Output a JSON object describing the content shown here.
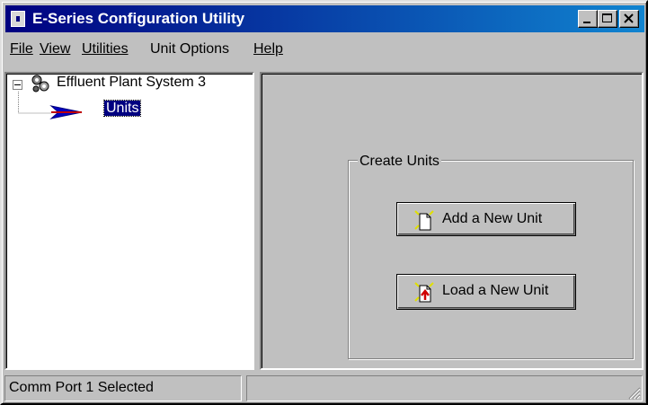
{
  "window": {
    "title": "E-Series Configuration Utility",
    "controls": {
      "minimize": "minimize",
      "maximize": "maximize",
      "close": "close"
    }
  },
  "menu": {
    "items": [
      {
        "label": "File",
        "access": "F"
      },
      {
        "label": "View",
        "access": "V"
      },
      {
        "label": "Utilities",
        "access": "U"
      },
      {
        "label": "Unit Options",
        "access": "O"
      },
      {
        "label": "Help",
        "access": "H"
      }
    ]
  },
  "tree": {
    "root": {
      "label": "Effluent Plant System 3",
      "expander": "⊟",
      "icon": "gears-icon"
    },
    "children": [
      {
        "label": "Units",
        "icon": "arrow-icon",
        "selected": true
      }
    ]
  },
  "create_units": {
    "group_label": "Create Units",
    "add_button": {
      "label": "Add a New Unit",
      "icon": "new-document-icon"
    },
    "load_button": {
      "label": "Load a New Unit",
      "icon": "load-document-icon"
    }
  },
  "status": {
    "text": "Comm Port 1 Selected",
    "second": ""
  },
  "colors": {
    "titlebar": "#000080",
    "face": "#c0c0c0",
    "selection": "#000080"
  }
}
